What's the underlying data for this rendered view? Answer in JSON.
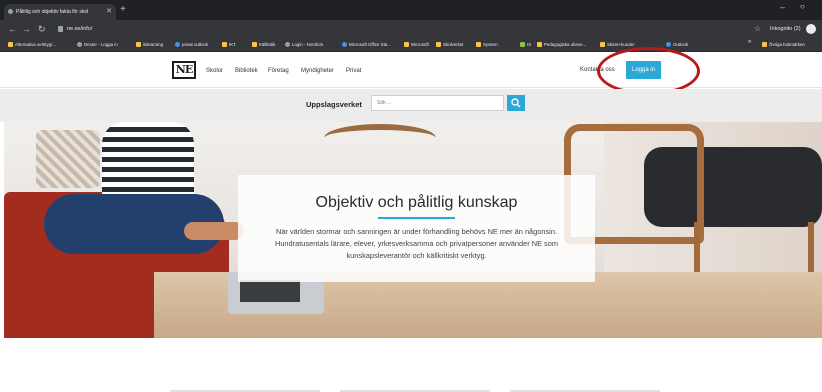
{
  "browser": {
    "tab_title": "Pålitlig och objektiv fakta för skol",
    "url": "ne.se/info/",
    "incognito_label": "Inkognito (2)",
    "bookmarks": [
      {
        "label": "Alternativa verktyg/...",
        "icon": "folder"
      },
      {
        "label": "Dexter - Logga in",
        "icon": "globe"
      },
      {
        "label": "itslearning",
        "icon": "folder"
      },
      {
        "label": "privat outlook",
        "icon": "outlook"
      },
      {
        "label": "IKT",
        "icon": "folder"
      },
      {
        "label": "Källkritik",
        "icon": "folder"
      },
      {
        "label": "Login - Nomfors",
        "icon": "globe"
      },
      {
        "label": "Microsoft Office Sta...",
        "icon": "outlook"
      },
      {
        "label": "Microsoft",
        "icon": "folder"
      },
      {
        "label": "Skolverket",
        "icon": "folder"
      },
      {
        "label": "System",
        "icon": "folder"
      },
      {
        "label": "IS",
        "icon": "green"
      },
      {
        "label": "Pedagogiska obese...",
        "icon": "folder"
      },
      {
        "label": "Skarm-kunder",
        "icon": "folder"
      },
      {
        "label": "Outlook",
        "icon": "outlook"
      },
      {
        "label": "Övriga bokmärken",
        "icon": "folder"
      }
    ],
    "more_bookmarks": "»"
  },
  "site": {
    "logo_text": "NE",
    "nav": [
      "Skolor",
      "Bibliotek",
      "Företag",
      "Myndigheter",
      "Privat"
    ],
    "contact": "Kontakta oss",
    "login": "Logga in",
    "search_label": "Uppslagsverket",
    "search_placeholder": "Sök ..."
  },
  "hero": {
    "title": "Objektiv och pålitlig kunskap",
    "text": "När världen stormar och sanningen är under förhandling behövs NE mer än någonsin. Hundratusentals lärare, elever, yrkesverksamma och privatpersoner använder NE som kunskapsleverantör och källkritiskt verktyg."
  },
  "colors": {
    "accent": "#2aa9d6",
    "annotation_ring": "#b71a1a",
    "browser_dark": "#202124",
    "toolbar": "#35363a"
  }
}
